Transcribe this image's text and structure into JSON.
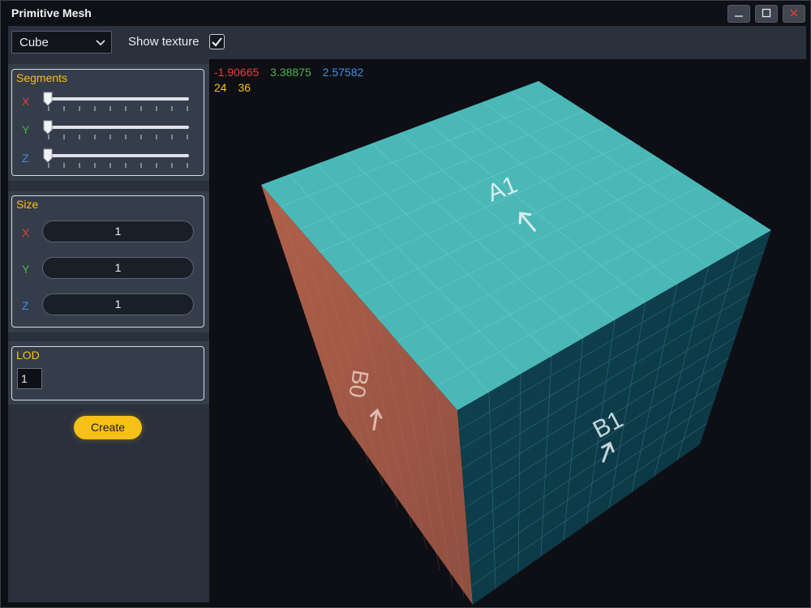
{
  "window": {
    "title": "Primitive Mesh"
  },
  "titlebar_buttons": {
    "minimize": "—",
    "maximize": "☐",
    "close": "✕"
  },
  "toolbar": {
    "shape_select": {
      "value": "Cube"
    },
    "show_texture": {
      "label": "Show texture",
      "checked": true
    }
  },
  "segments": {
    "title": "Segments",
    "axes": [
      {
        "label": "X",
        "value": 0
      },
      {
        "label": "Y",
        "value": 0
      },
      {
        "label": "Z",
        "value": 0
      }
    ]
  },
  "size": {
    "title": "Size",
    "axes": [
      {
        "label": "X",
        "value": "1"
      },
      {
        "label": "Y",
        "value": "1"
      },
      {
        "label": "Z",
        "value": "1"
      }
    ]
  },
  "lod": {
    "title": "LOD",
    "value": "1"
  },
  "create_button": {
    "label": "Create"
  },
  "viewport": {
    "coords": {
      "x": "-1.90665",
      "y": "3.38875",
      "z": "2.57582"
    },
    "stats": {
      "a": "24",
      "b": "36"
    },
    "faces": {
      "top": "A1",
      "front": "B1",
      "left": "B0"
    }
  },
  "colors": {
    "accent": "#f6c017",
    "axis_x": "#e0413a",
    "axis_y": "#47b549",
    "axis_z": "#3d8fe0",
    "panel_bg": "#2a303c",
    "cube_top": "#4bb8b8",
    "cube_front": "#0e3e4c",
    "cube_left": "#a45a48"
  }
}
